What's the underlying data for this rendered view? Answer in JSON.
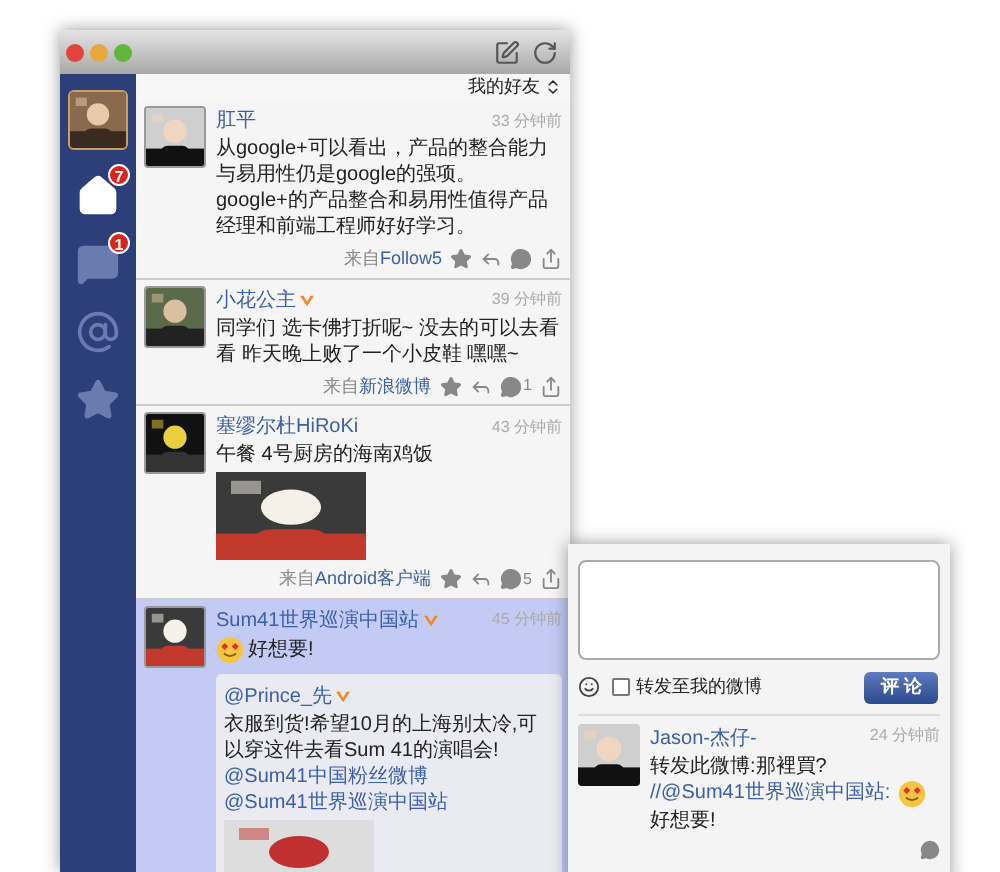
{
  "toolbar": {
    "filter": "我的好友"
  },
  "sidebar": {
    "items": [
      {
        "kind": "home",
        "badge": "7",
        "selected": true
      },
      {
        "kind": "messages",
        "badge": "1",
        "selected": false
      },
      {
        "kind": "mentions",
        "selected": false
      },
      {
        "kind": "favorites",
        "selected": false
      }
    ]
  },
  "tweets": [
    {
      "author": "肛平",
      "verified": false,
      "time": "33 分钟前",
      "highlighted": false,
      "text": [
        {
          "kind": "text",
          "text": "从google+可以看出，产品的整合能力与易用性仍是google的强项。google+的产品整合和易用性值得产品经理和前端工程师好好学习。"
        }
      ],
      "source_prefix": "来自",
      "source": "Follow5"
    },
    {
      "author": "小花公主",
      "verified": true,
      "time": "39 分钟前",
      "highlighted": false,
      "text": [
        {
          "kind": "text",
          "text": "同学们 选卡佛打折呢~ 没去的可以去看看 昨天晚上败了一个小皮鞋 嘿嘿~"
        }
      ],
      "source_prefix": "来自",
      "source": "新浪微博",
      "comments": "1"
    },
    {
      "author": "塞缪尔杜HiRoKi",
      "verified": false,
      "time": "43 分钟前",
      "highlighted": false,
      "text": [
        {
          "kind": "text",
          "text": "午餐 4号厨房的海南鸡饭"
        }
      ],
      "image": {
        "kind": "picture"
      },
      "source_prefix": "来自",
      "source": "Android客户端",
      "comments": "5"
    },
    {
      "author": "Sum41世界巡演中国站",
      "verified": true,
      "time": "45 分钟前",
      "highlighted": true,
      "text": [
        {
          "kind": "emoji"
        },
        {
          "kind": "text",
          "text": "好想要!"
        }
      ],
      "retweet": {
        "author": "@Prince_先",
        "verified": true,
        "text": [
          {
            "kind": "text",
            "text": "衣服到货!希望10月的上海别太冷,可以穿这件去看Sum 41的演唱会! "
          },
          {
            "kind": "link",
            "text": "@Sum41中国粉丝微博"
          },
          {
            "kind": "link",
            "text": "@Sum41世界巡演中国站"
          }
        ],
        "image": {
          "kind": "picture"
        }
      }
    }
  ],
  "comment_panel": {
    "repost_label": "转发至我的微博",
    "repost_checked": false,
    "submit": "评 论",
    "comments": [
      {
        "author": "Jason-杰仔-",
        "time": "24 分钟前",
        "text": [
          {
            "kind": "text",
            "text": "转发此微博:那裡買? "
          },
          {
            "kind": "link",
            "text": "//@Sum41世界巡演中国站:"
          },
          {
            "kind": "emoji"
          },
          {
            "kind": "text",
            "text": "好想要!"
          }
        ]
      }
    ]
  }
}
